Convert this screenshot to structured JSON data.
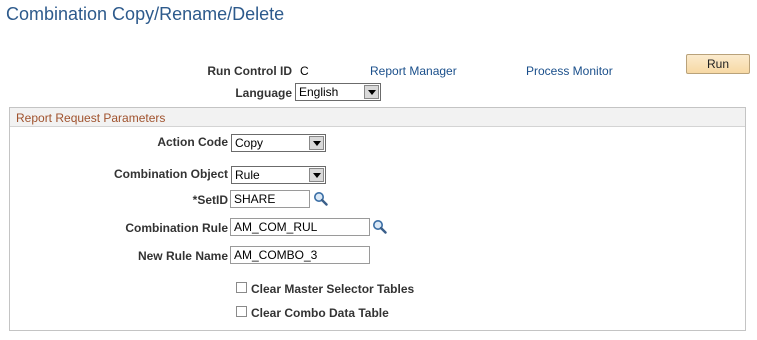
{
  "page": {
    "title": "Combination Copy/Rename/Delete"
  },
  "header": {
    "run_control_label": "Run Control ID",
    "run_control_value": "C",
    "report_manager_link": "Report Manager",
    "process_monitor_link": "Process Monitor",
    "run_button": "Run",
    "language_label": "Language",
    "language_value": "English"
  },
  "params": {
    "section_title": "Report Request Parameters",
    "action_code_label": "Action Code",
    "action_code_value": "Copy",
    "combination_object_label": "Combination Object",
    "combination_object_value": "Rule",
    "setid_label": "*SetID",
    "setid_value": "SHARE",
    "combination_rule_label": "Combination Rule",
    "combination_rule_value": "AM_COM_RUL",
    "new_rule_name_label": "New Rule Name",
    "new_rule_name_value": "AM_COMBO_3",
    "clear_master_label": "Clear Master Selector Tables",
    "clear_combo_label": "Clear Combo Data Table"
  },
  "icons": {
    "lookup": "magnifier-icon",
    "dropdown": "chevron-down-icon"
  },
  "colors": {
    "title": "#2d5a8c",
    "link": "#1a4f8b",
    "section_title": "#a0522d",
    "run_button_bg": "#f7d9a4"
  }
}
